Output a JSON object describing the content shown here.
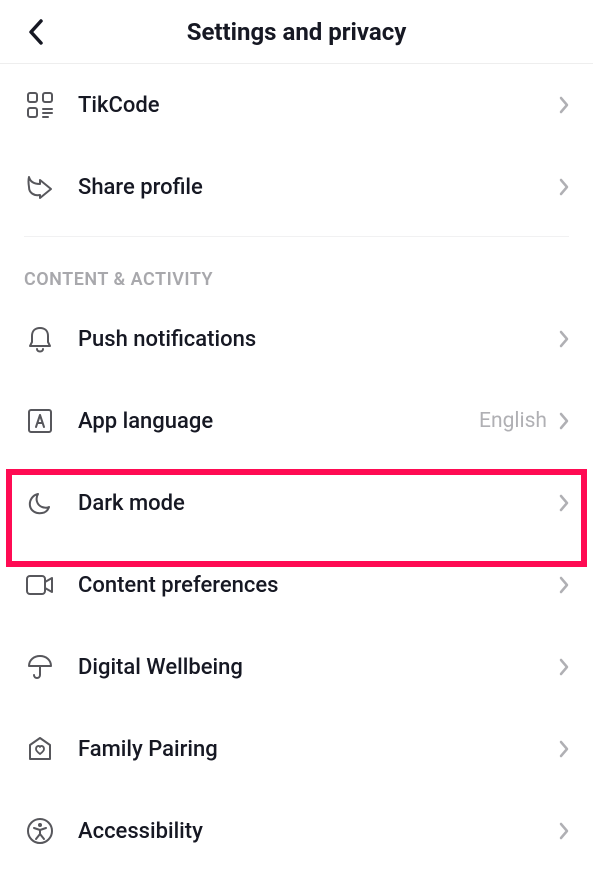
{
  "header": {
    "title": "Settings and privacy"
  },
  "topItems": [
    {
      "icon": "tikcode",
      "label": "TikCode"
    },
    {
      "icon": "share",
      "label": "Share profile"
    }
  ],
  "sectionTitle": "CONTENT & ACTIVITY",
  "items": [
    {
      "icon": "bell",
      "label": "Push notifications",
      "value": ""
    },
    {
      "icon": "language",
      "label": "App language",
      "value": "English"
    },
    {
      "icon": "moon",
      "label": "Dark mode",
      "value": "",
      "highlighted": true
    },
    {
      "icon": "video",
      "label": "Content preferences",
      "value": ""
    },
    {
      "icon": "umbrella",
      "label": "Digital Wellbeing",
      "value": ""
    },
    {
      "icon": "family",
      "label": "Family Pairing",
      "value": ""
    },
    {
      "icon": "accessibility",
      "label": "Accessibility",
      "value": ""
    }
  ]
}
